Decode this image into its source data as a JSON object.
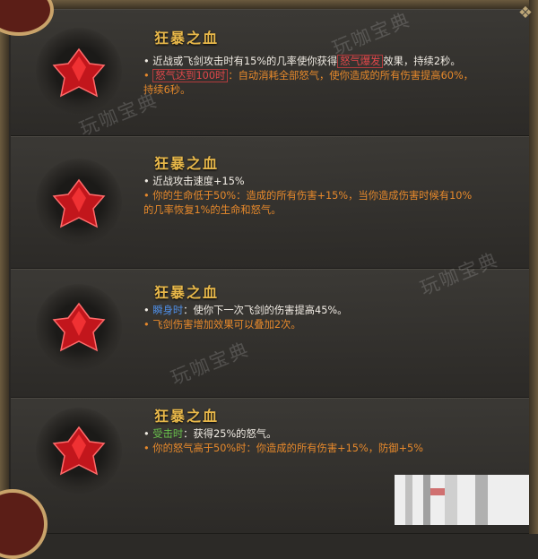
{
  "watermark": "玩咖宝典",
  "cards": [
    {
      "title": "狂暴之血",
      "lines": [
        {
          "bullet": "•",
          "pre": "近战或飞剑攻击时有15%的几率使你获得",
          "highlight": "怒气爆发",
          "post": "效果，持续2秒。"
        },
        {
          "bullet": "•",
          "highlight": "怒气达到100时",
          "post": "：自动消耗全部怒气，使你造成的所有伤害提高60%，"
        },
        {
          "text": "持续6秒。"
        }
      ]
    },
    {
      "title": "狂暴之血",
      "lines": [
        {
          "bullet": "•",
          "text": "近战攻击速度+15%"
        },
        {
          "bullet": "•",
          "text": "你的生命低于50%：造成的所有伤害+15%，当你造成伤害时候有10%"
        },
        {
          "text": "的几率恢复1%的生命和怒气。"
        }
      ]
    },
    {
      "title": "狂暴之血",
      "lines": [
        {
          "bullet": "•",
          "keyword": "瞬身时",
          "text": "：使你下一次飞剑的伤害提高45%。"
        },
        {
          "bullet": "•",
          "text": "飞剑伤害增加效果可以叠加2次。"
        }
      ]
    },
    {
      "title": "狂暴之血",
      "lines": [
        {
          "bullet": "•",
          "keyword": "受击时",
          "text": "：获得25%的怒气。"
        },
        {
          "bullet": "•",
          "text": "你的怒气高于50%时：你造成的所有伤害+15%，防御+5%"
        }
      ]
    }
  ],
  "colors": {
    "title": "#e8b84a",
    "orange": "#e7892b",
    "red": "#e2474a",
    "blue": "#4f8fe8",
    "green": "#69c24b"
  }
}
